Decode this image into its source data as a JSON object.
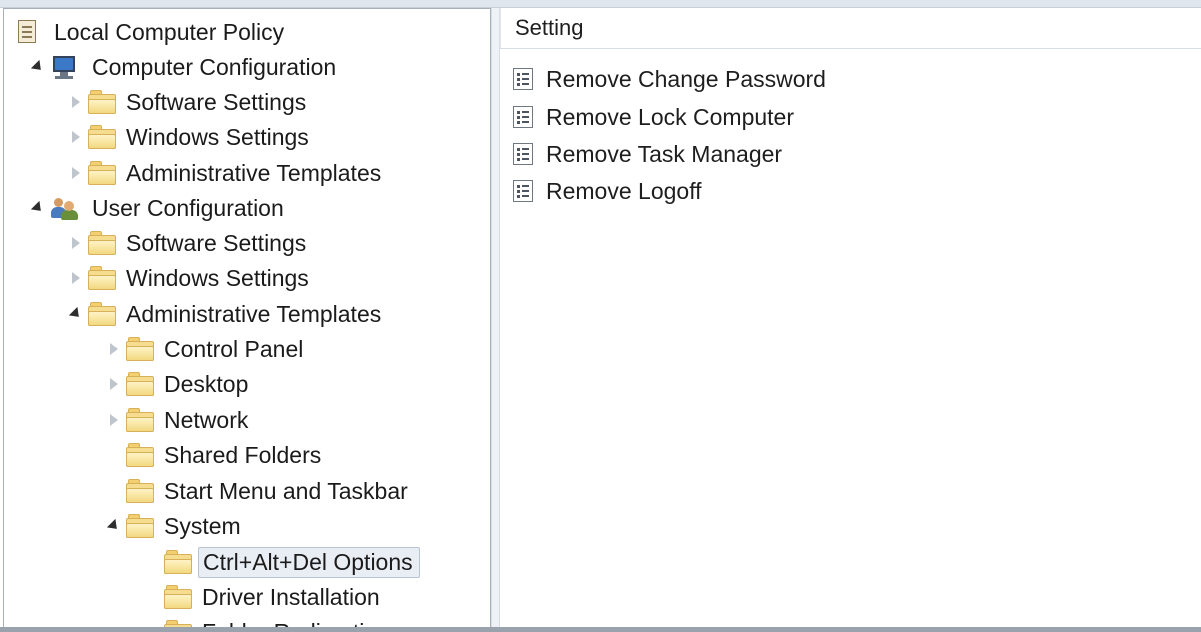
{
  "tree": {
    "root": {
      "label": "Local Computer Policy",
      "icon": "policy-icon"
    },
    "computer_configuration": {
      "label": "Computer Configuration",
      "icon": "computer-icon",
      "children": [
        "Software Settings",
        "Windows Settings",
        "Administrative Templates"
      ]
    },
    "user_configuration": {
      "label": "User Configuration",
      "icon": "users-icon",
      "children": [
        "Software Settings",
        "Windows Settings",
        "Administrative Templates"
      ]
    },
    "administrative_templates_children": [
      "Control Panel",
      "Desktop",
      "Network",
      "Shared Folders",
      "Start Menu and Taskbar",
      "System"
    ],
    "system_children": [
      "Ctrl+Alt+Del Options",
      "Driver Installation",
      "Folder Redirection"
    ],
    "selected": "Ctrl+Alt+Del Options"
  },
  "details": {
    "column_header": "Setting",
    "settings": [
      "Remove Change Password",
      "Remove Lock Computer",
      "Remove Task Manager",
      "Remove Logoff"
    ]
  }
}
